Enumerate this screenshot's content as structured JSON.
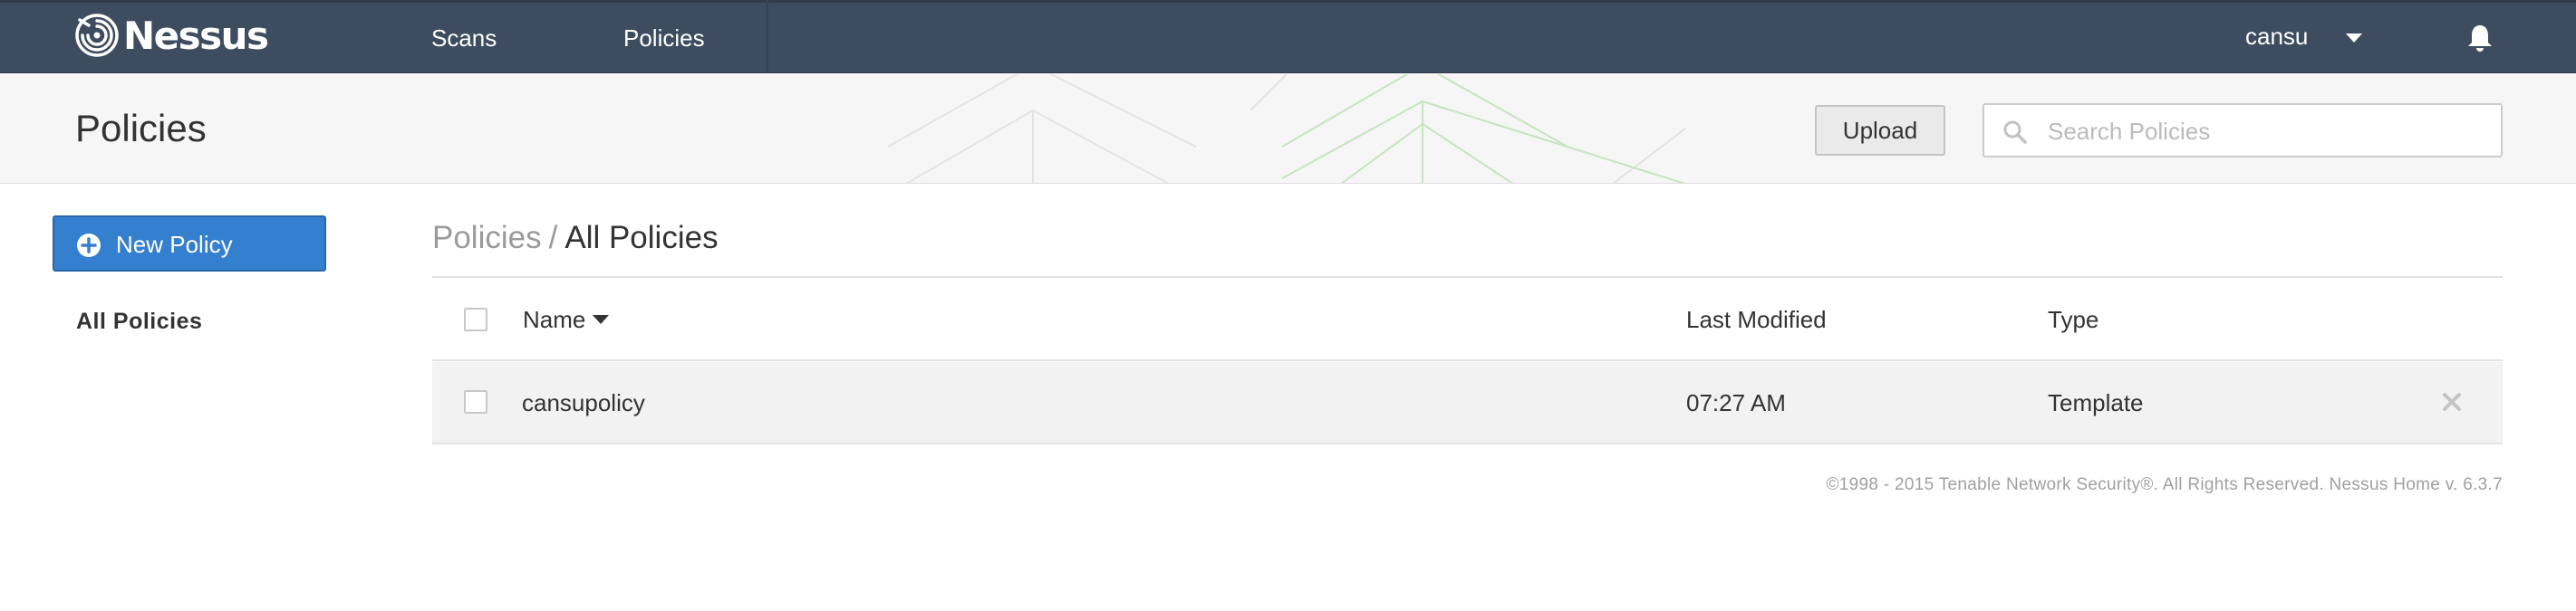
{
  "app": {
    "logo_text": "Nessus",
    "logo_icon": "nessus-swirl-icon"
  },
  "nav": {
    "items": [
      {
        "label": "Scans"
      },
      {
        "label": "Policies"
      }
    ],
    "user": {
      "name": "cansu",
      "icon": "chevron-down-icon"
    },
    "notifications_icon": "bell-icon"
  },
  "header": {
    "title": "Policies",
    "upload_label": "Upload",
    "search": {
      "placeholder": "Search Policies",
      "value": "",
      "icon": "search-icon"
    }
  },
  "sidebar": {
    "new_button_label": "New Policy",
    "new_button_icon": "plus-circle-icon",
    "items": [
      {
        "label": "All Policies",
        "active": true
      }
    ]
  },
  "main": {
    "breadcrumb": {
      "parent": "Policies",
      "separator": "/",
      "current": "All Policies"
    },
    "table": {
      "columns": [
        "Name",
        "Last Modified",
        "Type"
      ],
      "sort": {
        "column": "Name",
        "direction": "desc"
      },
      "rows": [
        {
          "name": "cansupolicy",
          "last_modified": "07:27 AM",
          "type": "Template",
          "selected": false
        }
      ]
    }
  },
  "footer": {
    "text": "©1998 - 2015 Tenable Network Security®. All Rights Reserved. Nessus Home v. 6.3.7"
  },
  "colors": {
    "topbar": "#3d4c5f",
    "primary_button": "#357fcf",
    "row_background": "#f2f2f2"
  }
}
